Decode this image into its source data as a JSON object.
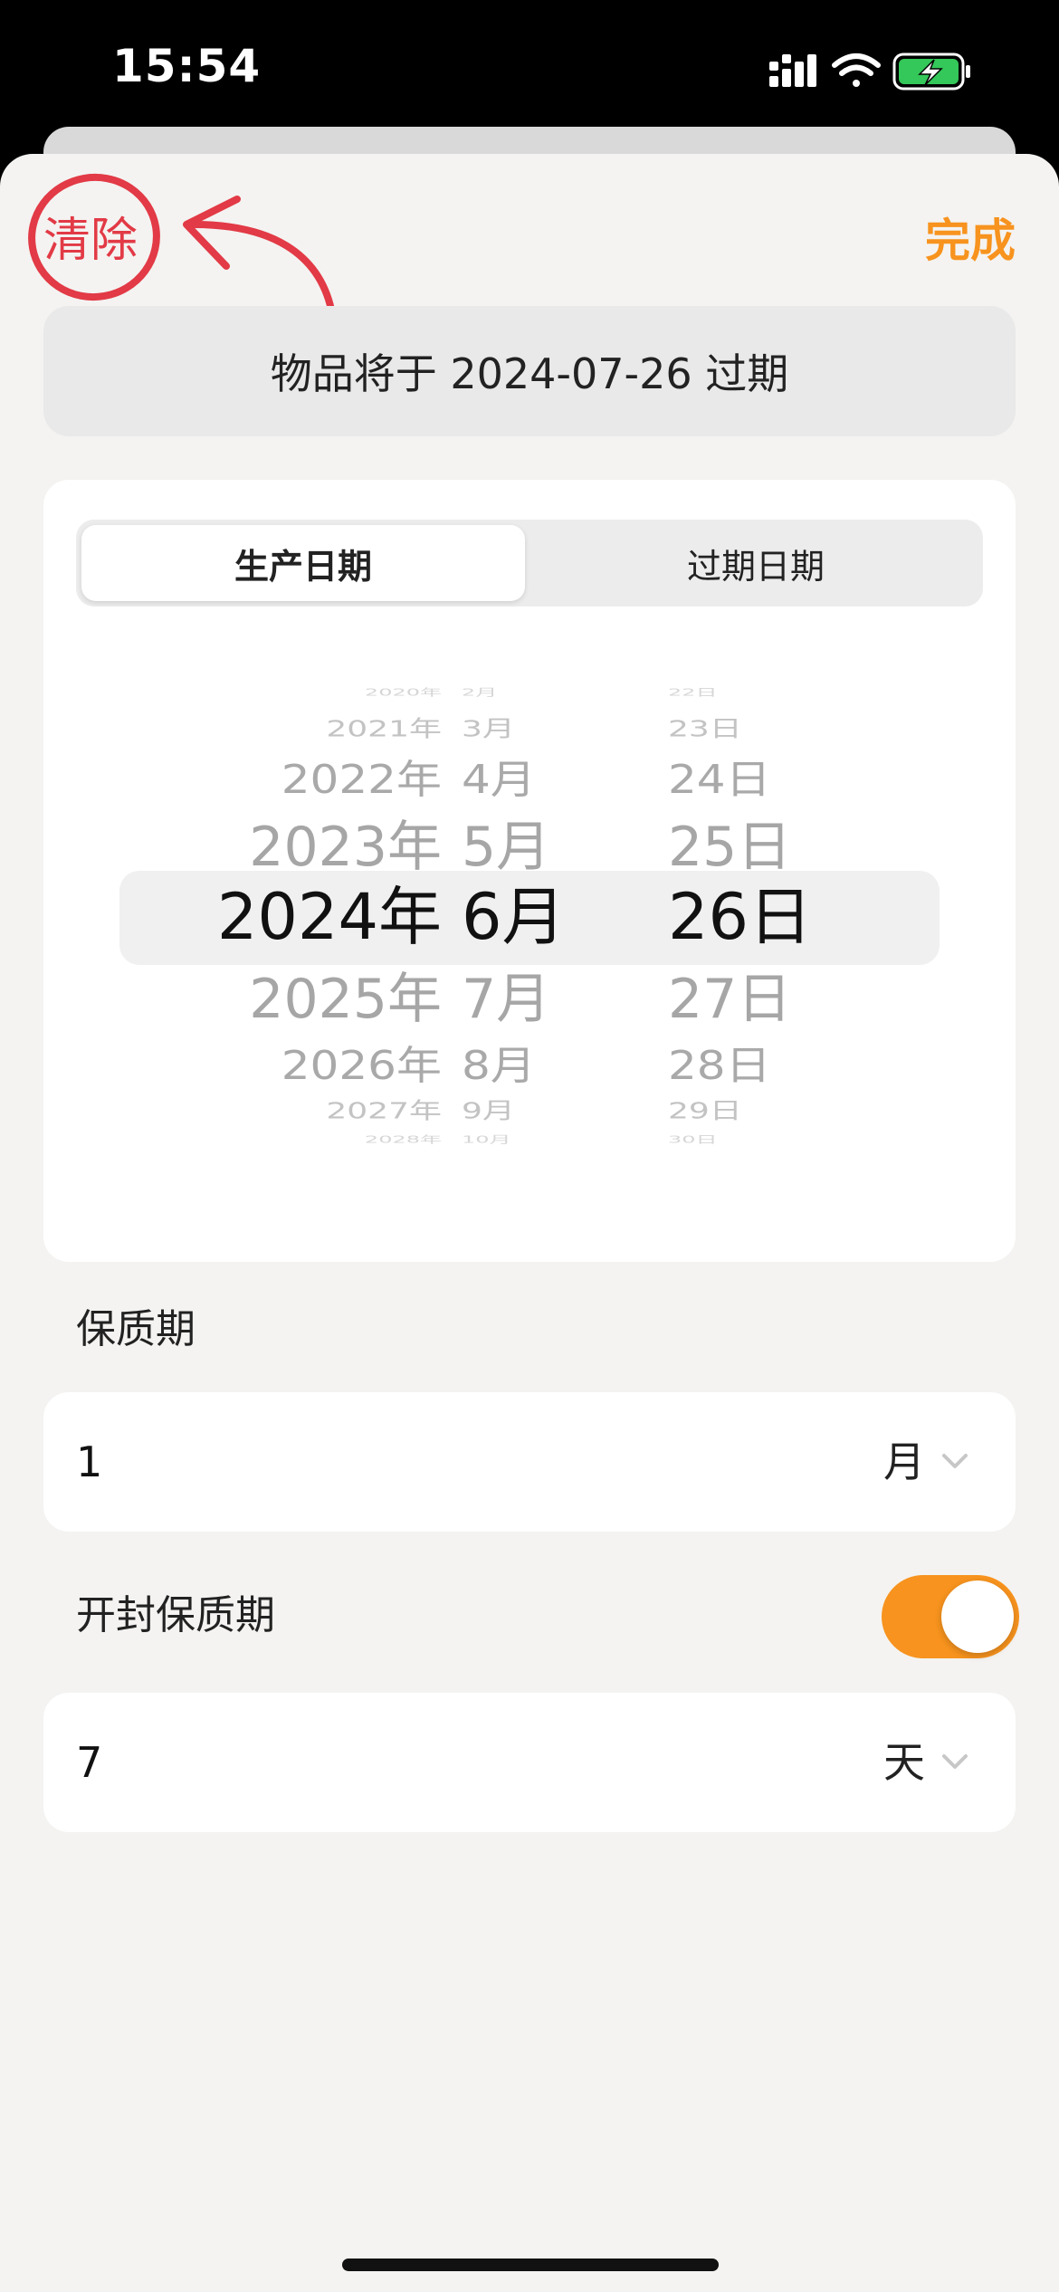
{
  "status_bar": {
    "time": "15:54"
  },
  "toolbar": {
    "clear_label": "清除",
    "done_label": "完成"
  },
  "banner": {
    "text": "物品将于 2024-07-26 过期"
  },
  "segmented": {
    "tabs": [
      {
        "label": "生产日期",
        "selected": true
      },
      {
        "label": "过期日期",
        "selected": false
      }
    ]
  },
  "picker": {
    "years": [
      "2020年",
      "2021年",
      "2022年",
      "2023年",
      "2024年",
      "2025年",
      "2026年",
      "2027年",
      "2028年"
    ],
    "months": [
      "2月",
      "3月",
      "4月",
      "5月",
      "6月",
      "7月",
      "8月",
      "9月",
      "10月"
    ],
    "days": [
      "22日",
      "23日",
      "24日",
      "25日",
      "26日",
      "27日",
      "28日",
      "29日",
      "30日"
    ],
    "selected": {
      "year": "2024年",
      "month": "6月",
      "day": "26日"
    }
  },
  "shelf_life": {
    "label": "保质期",
    "value": "1",
    "unit": "月"
  },
  "opened_shelf_life": {
    "label": "开封保质期",
    "enabled": true,
    "value": "7",
    "unit": "天"
  },
  "colors": {
    "accent": "#f7931e",
    "annotation": "#e23a46",
    "sheet_bg": "#f4f3f1"
  },
  "icons": {
    "chevron": "chevron-down-icon",
    "signal": "signal-icon",
    "wifi": "wifi-icon",
    "battery": "battery-charging-icon"
  }
}
